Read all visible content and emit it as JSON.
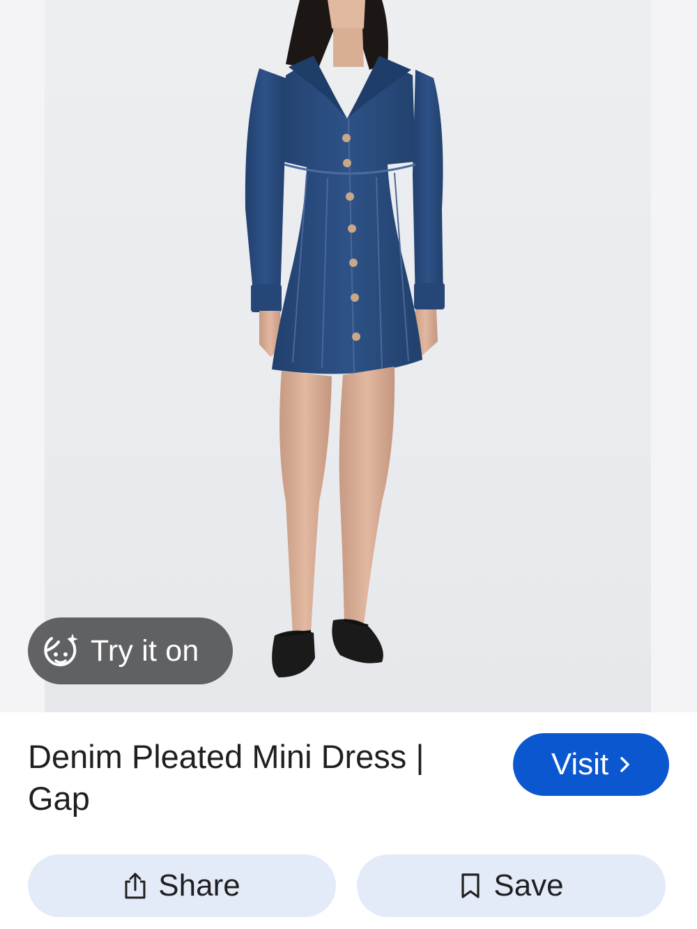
{
  "try_on": {
    "label": "Try it on",
    "icon": "face-sparkle-icon"
  },
  "product": {
    "title": "Denim Pleated Mini Dress | Gap"
  },
  "visit": {
    "label": "Visit",
    "icon": "chevron-right-icon"
  },
  "actions": {
    "share": {
      "label": "Share",
      "icon": "share-icon"
    },
    "save": {
      "label": "Save",
      "icon": "bookmark-icon"
    }
  },
  "colors": {
    "accent": "#0b57d0",
    "chip_background": "#e3ebf9",
    "pill_background": "#555557",
    "denim": "#2b4a7a"
  }
}
